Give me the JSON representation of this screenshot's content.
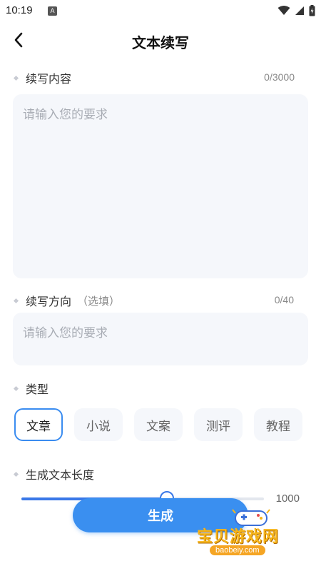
{
  "status_bar": {
    "time": "10:19",
    "notification_letter": "A"
  },
  "header": {
    "title": "文本续写"
  },
  "content_section": {
    "label": "续写内容",
    "counter": "0/3000",
    "placeholder": "请输入您的要求"
  },
  "direction_section": {
    "label": "续写方向",
    "optional": "（选填）",
    "counter": "0/40",
    "placeholder": "请输入您的要求"
  },
  "type_section": {
    "label": "类型",
    "options": [
      "文章",
      "小说",
      "文案",
      "测评",
      "教程"
    ],
    "selected": "文章"
  },
  "length_section": {
    "label": "生成文本长度",
    "value": "1000",
    "slider_fraction": 0.6
  },
  "generate_button": {
    "label": "生成"
  },
  "watermark": {
    "title": "宝贝游戏网",
    "url": "baobeiy.com"
  },
  "colors": {
    "accent": "#3a8ff0",
    "input_bg": "#f5f7fb",
    "watermark": "#f6b51b"
  }
}
